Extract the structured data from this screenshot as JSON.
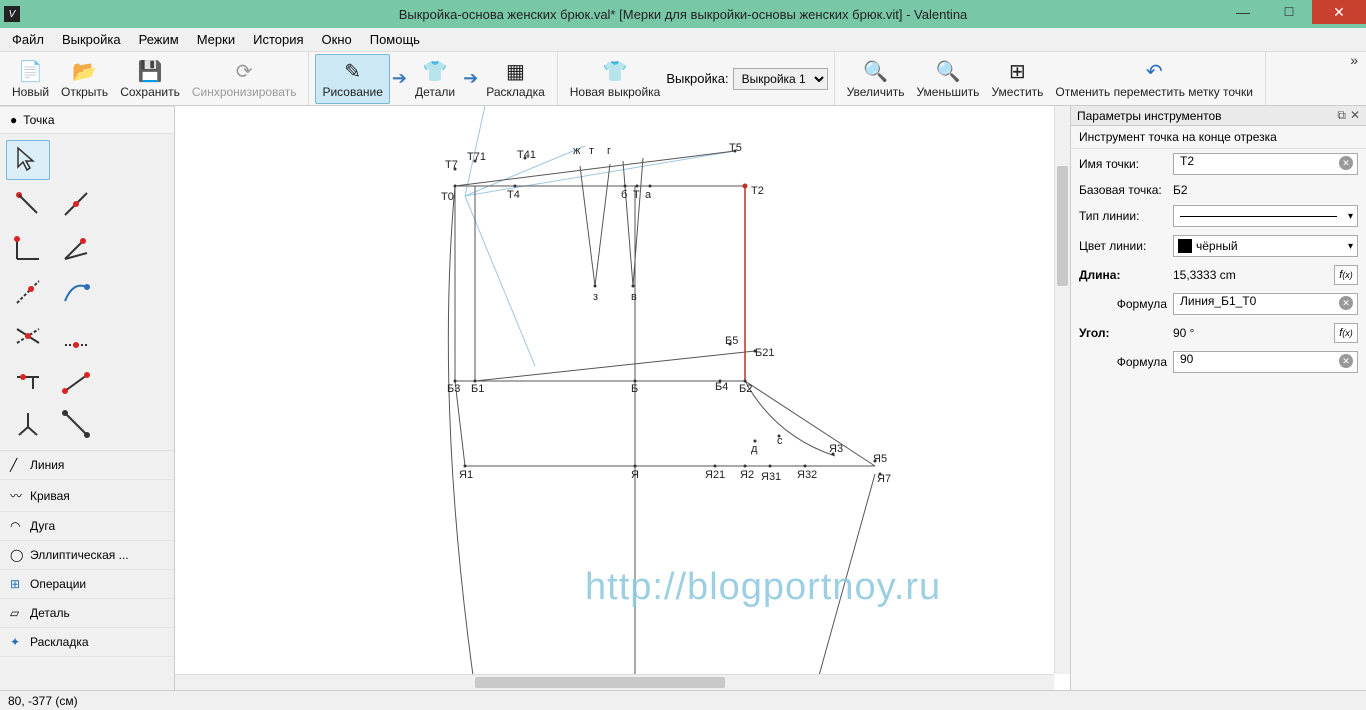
{
  "window": {
    "title": "Выкройка-основа женских брюк.val* [Мерки для выкройки-основы женских брюк.vit] - Valentina"
  },
  "menu": [
    "Файл",
    "Выкройка",
    "Режим",
    "Мерки",
    "История",
    "Окно",
    "Помощь"
  ],
  "toolbar": {
    "new": "Новый",
    "open": "Открыть",
    "save": "Сохранить",
    "sync": "Синхронизировать",
    "draw": "Рисование",
    "details": "Детали",
    "layout": "Раскладка",
    "newPattern": "Новая выкройка",
    "patternLabel": "Выкройка:",
    "patternSelected": "Выкройка 1",
    "zoomIn": "Увеличить",
    "zoomOut": "Уменьшить",
    "fit": "Уместить",
    "undoMove": "Отменить переместить метку точки"
  },
  "left": {
    "header": "Точка",
    "list": [
      "Линия",
      "Кривая",
      "Дуга",
      "Эллиптическая ...",
      "Операции",
      "Деталь",
      "Раскладка"
    ]
  },
  "props": {
    "title": "Параметры инструментов",
    "subtitle": "Инструмент точка на конце отрезка",
    "labels": {
      "pointName": "Имя точки:",
      "basePoint": "Базовая точка:",
      "lineType": "Тип линии:",
      "lineColor": "Цвет линии:",
      "length": "Длина:",
      "formula": "Формула",
      "angle": "Угол:"
    },
    "values": {
      "pointName": "Т2",
      "basePoint": "Б2",
      "color": "чёрный",
      "length": "15,3333 cm",
      "lengthFormula": "Линия_Б1_Т0",
      "angle": "90 °",
      "angleFormula": "90"
    }
  },
  "canvas": {
    "watermark": "http://blogportnoy.ru",
    "points": {
      "T7": "Т7",
      "T71": "Т71",
      "T41": "Т41",
      "zh": "ж",
      "t_low": "т",
      "g_low": "г",
      "T5": "Т5",
      "T0": "Т0",
      "T4": "Т4",
      "b_low": "б",
      "T": "Т",
      "a_low": "а",
      "T2": "Т2",
      "z_low": "з",
      "v_low": "в",
      "B5": "Б5",
      "B21_up": "Б21",
      "B3": "Б3",
      "B1": "Б1",
      "Bmid": "Б",
      "B4": "Б4",
      "B2": "Б2",
      "Ya1": "Я1",
      "Ya": "Я",
      "Ya21": "Я21",
      "Ya2": "Я2",
      "Ya31": "Я31",
      "Ya32": "Я32",
      "Ya3": "Я3",
      "Ya5": "Я5",
      "Ya7": "Я7",
      "d_low": "д",
      "s_low": "с"
    }
  },
  "status": {
    "coords": "80, -377 (см)"
  }
}
